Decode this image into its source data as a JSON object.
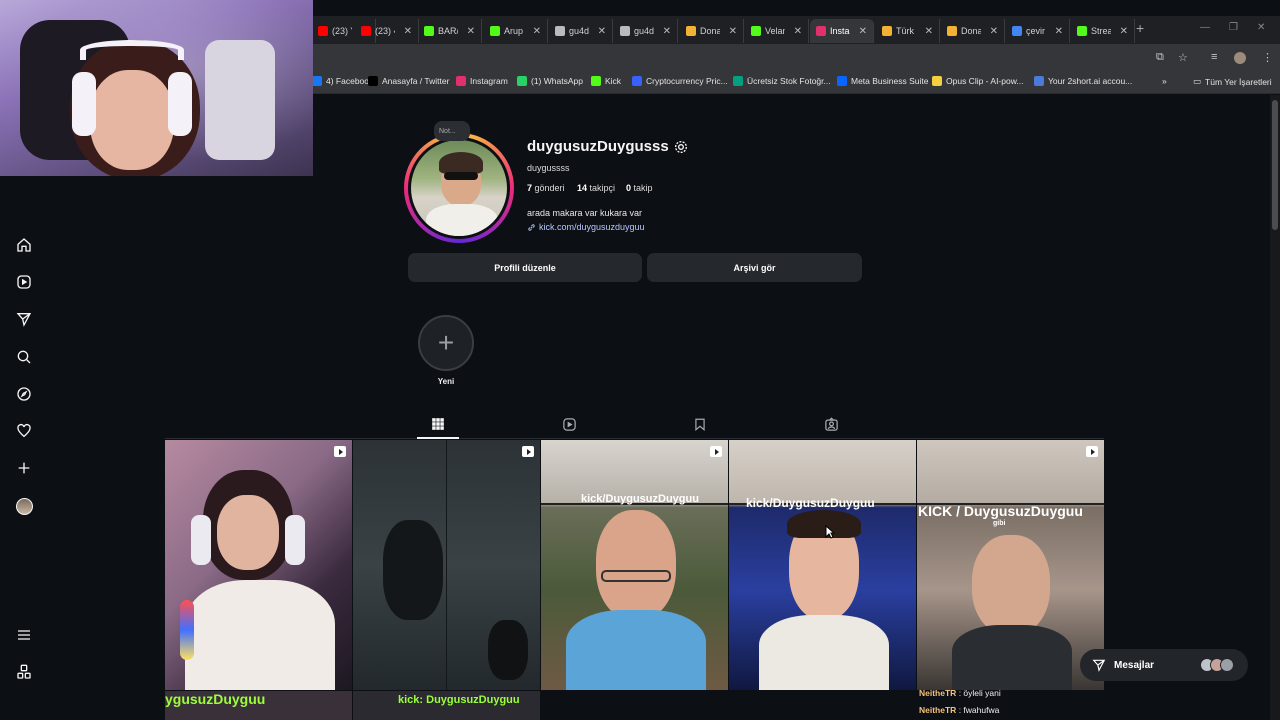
{
  "tabs": [
    {
      "title": "(23) Y",
      "icon": "youtube-icon",
      "color": "#ff0000",
      "active": false
    },
    {
      "title": "(23) ‹",
      "icon": "youtube-icon",
      "color": "#ff0000",
      "active": false
    },
    {
      "title": "BAR/",
      "icon": "kick-icon",
      "color": "#53fc18",
      "active": false
    },
    {
      "title": "Arup",
      "icon": "kick-icon",
      "color": "#53fc18",
      "active": false
    },
    {
      "title": "gu4d",
      "icon": "globe-icon",
      "color": "#bbbbbb",
      "active": false
    },
    {
      "title": "gu4d",
      "icon": "globe-icon",
      "color": "#bbbbbb",
      "active": false
    },
    {
      "title": "Dona",
      "icon": "donation-icon",
      "color": "#f2b233",
      "active": false
    },
    {
      "title": "Velan",
      "icon": "kick-icon",
      "color": "#53fc18",
      "active": false
    },
    {
      "title": "Insta",
      "icon": "instagram-icon",
      "color": "#e1306c",
      "active": true
    },
    {
      "title": "Türk",
      "icon": "donation-icon",
      "color": "#f2b233",
      "active": false
    },
    {
      "title": "Dona",
      "icon": "donation-icon",
      "color": "#f2b233",
      "active": false
    },
    {
      "title": "çevir",
      "icon": "google-icon",
      "color": "#4285f4",
      "active": false
    },
    {
      "title": "Strea",
      "icon": "kick-icon",
      "color": "#53fc18",
      "active": false
    }
  ],
  "bookmarks": [
    {
      "label": "4) Facebook",
      "icon": "facebook-icon",
      "color": "#1877f2"
    },
    {
      "label": "Anasayfa / Twitter",
      "icon": "x-icon",
      "color": "#000000"
    },
    {
      "label": "Instagram",
      "icon": "instagram-icon",
      "color": "#e1306c"
    },
    {
      "label": "(1) WhatsApp",
      "icon": "whatsapp-icon",
      "color": "#25d366"
    },
    {
      "label": "Kick",
      "icon": "kick-icon",
      "color": "#53fc18"
    },
    {
      "label": "Cryptocurrency Pric...",
      "icon": "coin-icon",
      "color": "#3861fb"
    },
    {
      "label": "Ücretsiz Stok Fotoğr...",
      "icon": "pexels-icon",
      "color": "#05a081"
    },
    {
      "label": "Meta Business Suite",
      "icon": "meta-icon",
      "color": "#0866ff"
    },
    {
      "label": "Opus Clip - AI-pow...",
      "icon": "opus-icon",
      "color": "#f4d03f"
    },
    {
      "label": "Your 2short.ai accou...",
      "icon": "dash-icon",
      "color": "#4a7bd9"
    }
  ],
  "bookmarks_more": "»",
  "bookmarks_all": "Tüm Yer İşaretleri",
  "profile": {
    "username": "duygusuzDuygusss",
    "note": "Not...",
    "fullname": "duygussss",
    "posts_count": "7",
    "posts_label": "gönderi",
    "followers_count": "14",
    "followers_label": "takipçi",
    "following_count": "0",
    "following_label": "takip",
    "bio": "arada makara var kukara var",
    "link": "kick.com/duygusuzduyguu",
    "edit_button": "Profili düzenle",
    "archive_button": "Arşivi gör",
    "new_highlight": "Yeni"
  },
  "posts": [
    {
      "overlay": ""
    },
    {
      "overlay": ""
    },
    {
      "overlay": "kick/DuygusuzDuyguu"
    },
    {
      "overlay": "kick/DuygusuzDuyguu"
    },
    {
      "overlay": "KICK / DuygusuzDuyguu"
    },
    {
      "overlay": "gibi"
    }
  ],
  "bottom_overlays": [
    "ygusuzDuyguu",
    "kick: DuygusuzDuyguu"
  ],
  "messages_label": "Mesajlar",
  "chat": [
    {
      "user": "NeitheTR",
      "text": ": öyleli yani"
    },
    {
      "user": "NeitheTR",
      "text": ": fwahufwa"
    }
  ]
}
